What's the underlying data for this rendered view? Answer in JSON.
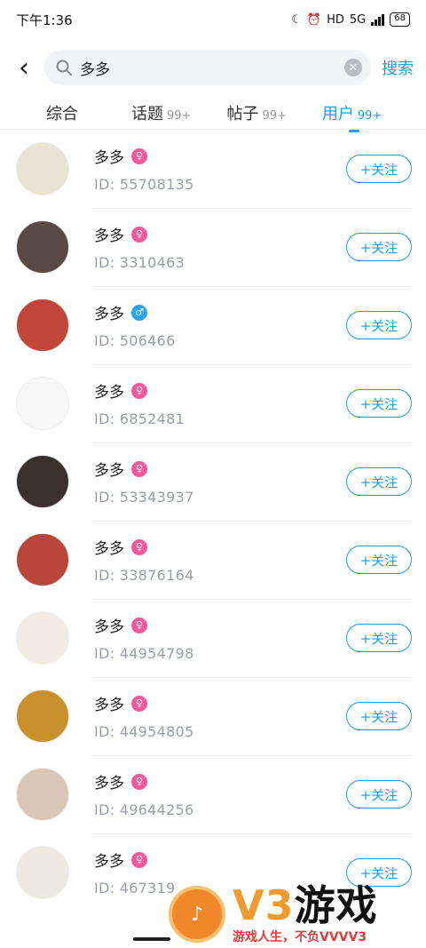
{
  "status": {
    "time": "下午1:36",
    "network": "5G",
    "hd": "HD",
    "battery": "68"
  },
  "search": {
    "query": "多多",
    "submit_label": "搜索"
  },
  "tabs": [
    {
      "label": "综合",
      "count": ""
    },
    {
      "label": "话题",
      "count": "99+"
    },
    {
      "label": "帖子",
      "count": "99+"
    },
    {
      "label": "用户",
      "count": "99+"
    }
  ],
  "active_tab": "用户",
  "follow_label": "+关注",
  "users": [
    {
      "name": "多多",
      "gender": "female",
      "id": "ID: 55708135",
      "avatar_color": "#e9e3d6"
    },
    {
      "name": "多多",
      "gender": "female",
      "id": "ID: 3310463",
      "avatar_color": "#5a4a46"
    },
    {
      "name": "多多",
      "gender": "male",
      "id": "ID: 506466",
      "avatar_color": "#c2453a"
    },
    {
      "name": "多多",
      "gender": "female",
      "id": "ID: 6852481",
      "avatar_color": "#f7f7f7"
    },
    {
      "name": "多多",
      "gender": "female",
      "id": "ID: 53343937",
      "avatar_color": "#3a3030"
    },
    {
      "name": "多多",
      "gender": "female",
      "id": "ID: 33876164",
      "avatar_color": "#b8463b"
    },
    {
      "name": "多多",
      "gender": "female",
      "id": "ID: 44954798",
      "avatar_color": "#f1ebe4"
    },
    {
      "name": "多多",
      "gender": "female",
      "id": "ID: 44954805",
      "avatar_color": "#c9912e"
    },
    {
      "name": "多多",
      "gender": "female",
      "id": "ID: 49644256",
      "avatar_color": "#d8c6b6"
    },
    {
      "name": "多多",
      "gender": "female",
      "id": "ID: 467319",
      "avatar_color": "#ece9e2"
    }
  ],
  "watermark": {
    "brand": "V3",
    "brand_cn": "游戏",
    "slogan": "游戏人生，不负VVVV3"
  },
  "colors": {
    "accent": "#1d9fe0",
    "female": "#f35a9e",
    "male": "#2aa4ee"
  },
  "icons": {
    "back": "chevron-left-icon",
    "search": "search-icon",
    "clear": "clear-icon",
    "female": "female-icon",
    "male": "male-icon"
  }
}
